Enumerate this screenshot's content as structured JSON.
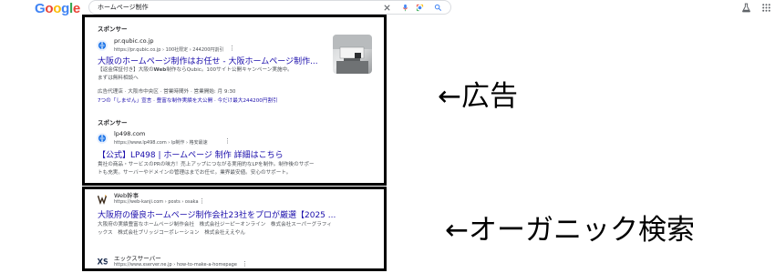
{
  "header": {
    "logo": [
      "G",
      "o",
      "o",
      "g",
      "l",
      "e"
    ],
    "query": "ホームページ制作",
    "icons": [
      "close-icon",
      "mic-icon",
      "lens-icon",
      "search-icon",
      "labs-icon",
      "apps-icon"
    ],
    "colors": {
      "blue": "#4285F4",
      "red": "#EA4335",
      "yellow": "#FBBC05",
      "green": "#34A853",
      "link": "#1a0dab"
    }
  },
  "ads": [
    {
      "sponsor": "スポンサー",
      "site": "pr.qubic.co.jp",
      "url": "https://pr.qubic.co.jp › 100社限定 › 244200円割引",
      "title": "大阪のホームページ制作はお任せ - 大阪ホームページ制作...",
      "desc1_pre": "【返金保証付き】大阪の",
      "desc1_bold": "Web",
      "desc1_post": "制作ならQubic。100サイト公開キャンペーン実施中。",
      "desc2": "まずは無料相談へ",
      "info": "広告代理店 · 大阪市中央区 · 営業時間外 · 営業開始: 月 9:30",
      "sitelinks": "7つの「しません」宣言 · 豊富な制作実績を大公開 · 今だけ最大244200円割引"
    },
    {
      "sponsor": "スポンサー",
      "site": "lp498.com",
      "url": "https://www.lp498.com › lp制作 › 格安最速",
      "title": "【公式】LP498 | ホームページ 制作 詳細はこちら",
      "desc1": "貴社の商品・サービスのPRの味方！売上アップにつながる実用的なLPを制作。制作後のサポー",
      "desc2": "トも充実。サーバーやドメインの管理はまでお任せ。業界最安値。安心のサポート。"
    }
  ],
  "organic": [
    {
      "site": "Web幹事",
      "url": "https://web-kanji.com › posts › osaka",
      "title": "大阪府の優良ホームページ制作会社23社をプロが厳選【2025 ...",
      "desc1": "大阪府の実績豊富なホームページ制作会社　株式会社ジーピーオンライン　株式会社スーパーグラフィ",
      "desc2": "ックス　株式会社ブリッジコーポレーション　株式会社ええやん"
    },
    {
      "site": "エックスサーバー",
      "url": "https://www.xserver.ne.jp › how-to-make-a-homepage"
    }
  ],
  "annotations": {
    "ad_label": "←広告",
    "organic_label": "←オーガニック検索"
  }
}
